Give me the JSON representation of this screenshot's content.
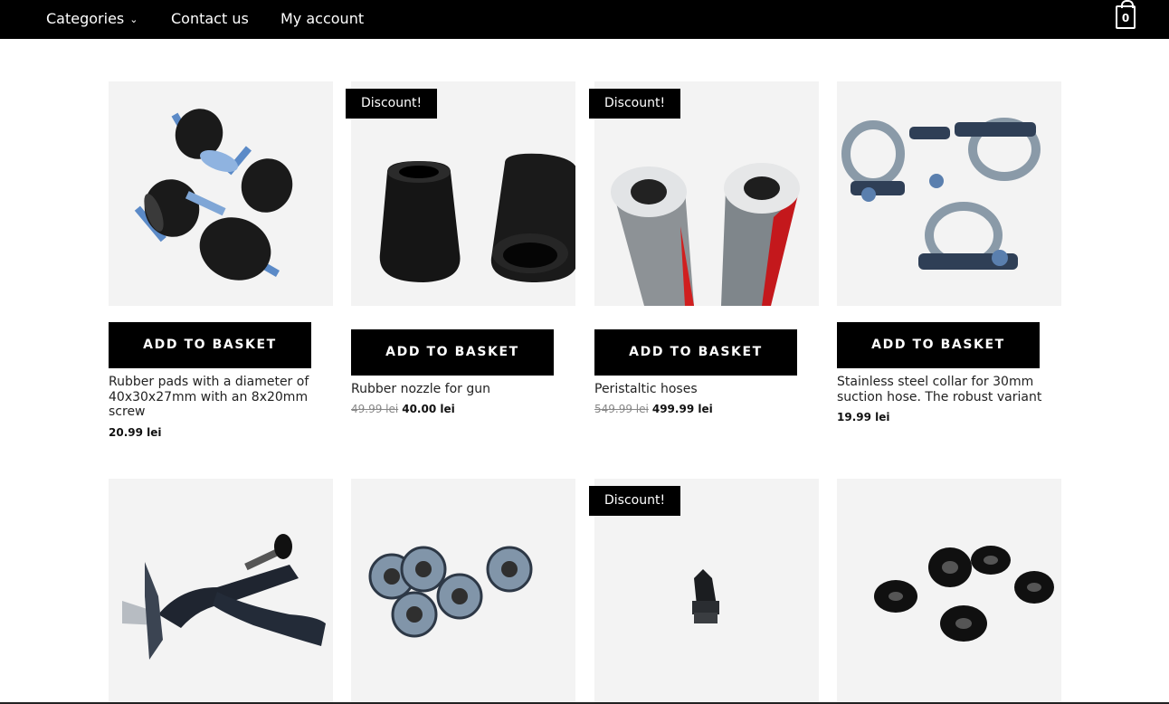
{
  "nav": {
    "categories_label": "Categories",
    "contact_label": "Contact us",
    "account_label": "My account",
    "cart_count": "0"
  },
  "products": [
    {
      "button_label": "ADD TO BASKET",
      "title": "Rubber pads with a diameter of 40x30x27mm with an 8x20mm screw",
      "price": "20.99 lei"
    },
    {
      "badge": "Discount!",
      "button_label": "ADD TO BASKET",
      "title": "Rubber nozzle for gun",
      "old_price": "49.99 lei",
      "price": "40.00 lei"
    },
    {
      "badge": "Discount!",
      "button_label": "ADD TO BASKET",
      "title": "Peristaltic hoses",
      "old_price": "549.99 lei",
      "price": "499.99 lei"
    },
    {
      "button_label": "ADD TO BASKET",
      "title": "Stainless steel collar for 30mm suction hose. The robust variant",
      "price": "19.99 lei"
    },
    {},
    {},
    {
      "badge": "Discount!"
    },
    {}
  ],
  "colors": {
    "bar": "#000000",
    "thumb_bg": "#f3f3f3",
    "hose_stripe": "#d01f1f"
  }
}
